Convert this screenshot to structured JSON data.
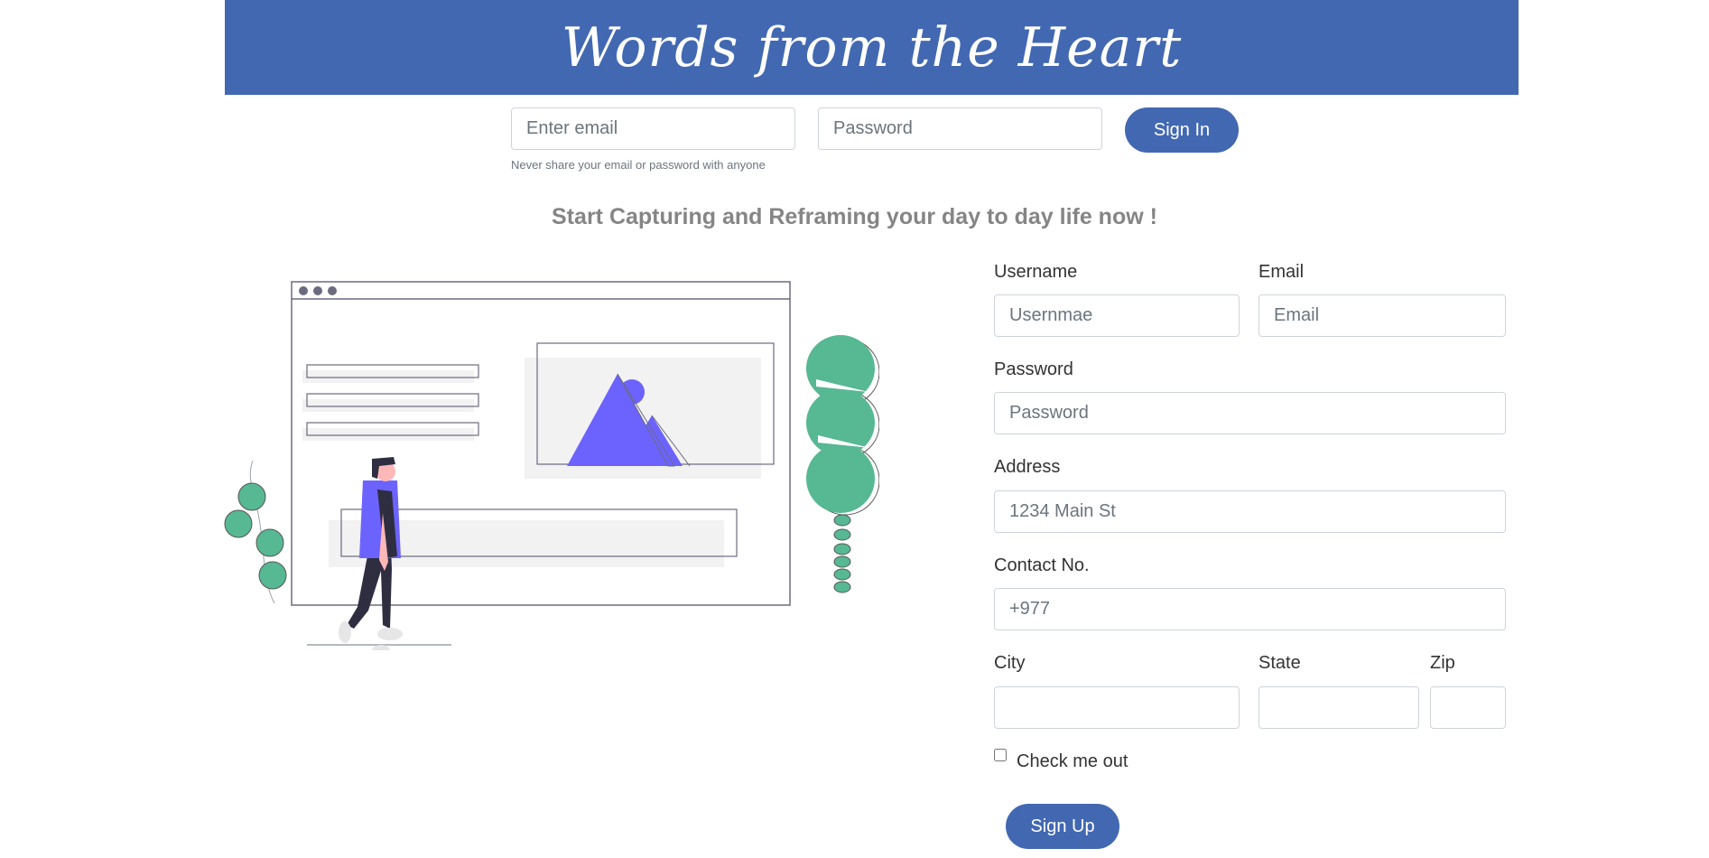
{
  "header": {
    "title": "Words from the Heart"
  },
  "signin": {
    "email_placeholder": "Enter email",
    "password_placeholder": "Password",
    "button_label": "Sign In",
    "hint": "Never share your email or password with anyone"
  },
  "tagline": "Start Capturing and Reframing your day to day life now !",
  "signup": {
    "username_label": "Username",
    "username_placeholder": "Usernmae",
    "email_label": "Email",
    "email_placeholder": "Email",
    "password_label": "Password",
    "password_placeholder": "Password",
    "address_label": "Address",
    "address_placeholder": "1234 Main St",
    "contact_label": "Contact No.",
    "contact_placeholder": "+977",
    "city_label": "City",
    "state_label": "State",
    "zip_label": "Zip",
    "checkbox_label": "Check me out",
    "button_label": "Sign Up"
  },
  "colors": {
    "brand": "#4268b2",
    "illustration_accent": "#6c63ff",
    "plant_green": "#57b894"
  },
  "illustration": {
    "icon": "person-browsing-website-illustration"
  }
}
